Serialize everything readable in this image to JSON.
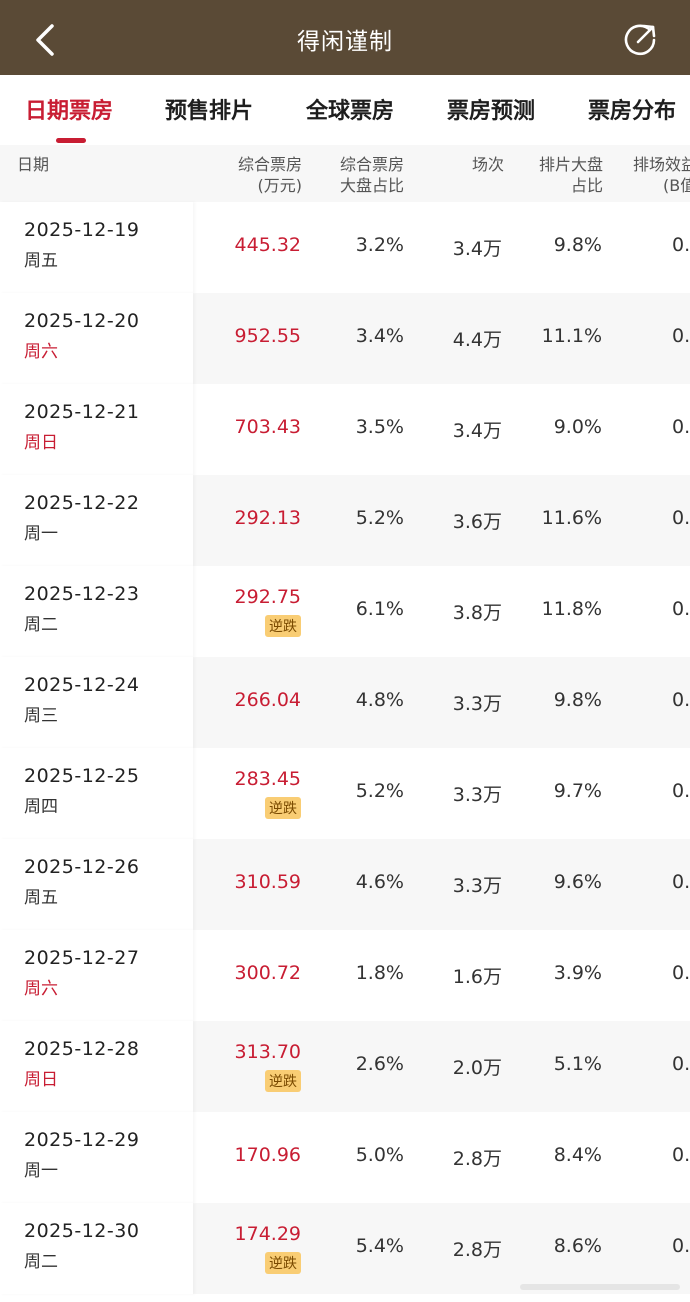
{
  "topbar": {
    "title": "得闲谨制"
  },
  "tabs": [
    {
      "label": "日期票房",
      "active": true
    },
    {
      "label": "预售排片",
      "active": false
    },
    {
      "label": "全球票房",
      "active": false
    },
    {
      "label": "票房预测",
      "active": false
    },
    {
      "label": "票房分布",
      "active": false
    }
  ],
  "columns": {
    "date": "日期",
    "boxoffice_line1": "综合票房",
    "boxoffice_line2": "(万元)",
    "share_line1": "综合票房",
    "share_line2": "大盘占比",
    "screenings": "场次",
    "schedule_line1": "排片大盘",
    "schedule_line2": "占比",
    "efficiency_line1": "排场效益",
    "efficiency_line2": "(B值"
  },
  "rows": [
    {
      "date": "2025-12-19",
      "weekday": "周五",
      "weekend": false,
      "boxoffice": "445.32",
      "badge": "",
      "share": "3.2%",
      "screenings": "3.4万",
      "schedule": "9.8%",
      "efficiency": "0."
    },
    {
      "date": "2025-12-20",
      "weekday": "周六",
      "weekend": true,
      "boxoffice": "952.55",
      "badge": "",
      "share": "3.4%",
      "screenings": "4.4万",
      "schedule": "11.1%",
      "efficiency": "0."
    },
    {
      "date": "2025-12-21",
      "weekday": "周日",
      "weekend": true,
      "boxoffice": "703.43",
      "badge": "",
      "share": "3.5%",
      "screenings": "3.4万",
      "schedule": "9.0%",
      "efficiency": "0."
    },
    {
      "date": "2025-12-22",
      "weekday": "周一",
      "weekend": false,
      "boxoffice": "292.13",
      "badge": "",
      "share": "5.2%",
      "screenings": "3.6万",
      "schedule": "11.6%",
      "efficiency": "0."
    },
    {
      "date": "2025-12-23",
      "weekday": "周二",
      "weekend": false,
      "boxoffice": "292.75",
      "badge": "逆跌",
      "share": "6.1%",
      "screenings": "3.8万",
      "schedule": "11.8%",
      "efficiency": "0."
    },
    {
      "date": "2025-12-24",
      "weekday": "周三",
      "weekend": false,
      "boxoffice": "266.04",
      "badge": "",
      "share": "4.8%",
      "screenings": "3.3万",
      "schedule": "9.8%",
      "efficiency": "0."
    },
    {
      "date": "2025-12-25",
      "weekday": "周四",
      "weekend": false,
      "boxoffice": "283.45",
      "badge": "逆跌",
      "share": "5.2%",
      "screenings": "3.3万",
      "schedule": "9.7%",
      "efficiency": "0."
    },
    {
      "date": "2025-12-26",
      "weekday": "周五",
      "weekend": false,
      "boxoffice": "310.59",
      "badge": "",
      "share": "4.6%",
      "screenings": "3.3万",
      "schedule": "9.6%",
      "efficiency": "0."
    },
    {
      "date": "2025-12-27",
      "weekday": "周六",
      "weekend": true,
      "boxoffice": "300.72",
      "badge": "",
      "share": "1.8%",
      "screenings": "1.6万",
      "schedule": "3.9%",
      "efficiency": "0."
    },
    {
      "date": "2025-12-28",
      "weekday": "周日",
      "weekend": true,
      "boxoffice": "313.70",
      "badge": "逆跌",
      "share": "2.6%",
      "screenings": "2.0万",
      "schedule": "5.1%",
      "efficiency": "0."
    },
    {
      "date": "2025-12-29",
      "weekday": "周一",
      "weekend": false,
      "boxoffice": "170.96",
      "badge": "",
      "share": "5.0%",
      "screenings": "2.8万",
      "schedule": "8.4%",
      "efficiency": "0."
    },
    {
      "date": "2025-12-30",
      "weekday": "周二",
      "weekend": false,
      "boxoffice": "174.29",
      "badge": "逆跌",
      "share": "5.4%",
      "screenings": "2.8万",
      "schedule": "8.6%",
      "efficiency": "0."
    }
  ],
  "colors": {
    "topbar": "#5a4a36",
    "accent": "#c81d33",
    "badge": "#f9cd74"
  },
  "icons": {
    "back": "chevron-left-icon",
    "share": "share-arrow-icon"
  }
}
